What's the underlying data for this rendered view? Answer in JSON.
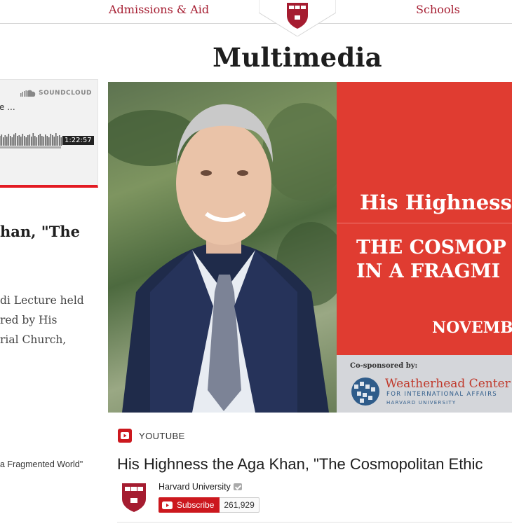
{
  "nav": {
    "admissions_label": "Admissions & Aid",
    "schools_label": "Schools",
    "logo": "harvard-shield-icon"
  },
  "page": {
    "title": "Multimedia"
  },
  "soundcloud": {
    "brand": "SOUNDCLOUD",
    "track_title_fragment": "e ...",
    "duration": "1:22:57",
    "accent_color": "#e31b23"
  },
  "left_article": {
    "heading_fragment": "han, \"The",
    "body_lines": [
      "di Lecture held",
      "red by His",
      "rial Church,"
    ],
    "caption_fragment": "a Fragmented World\""
  },
  "video": {
    "graphic": {
      "line1": "His Highness",
      "line2a": "THE COSMOP",
      "line2b": "IN A FRAGMI",
      "line3": "NOVEMB",
      "cosponsor_label": "Co-sponsored by:",
      "cosponsor_name": "Weatherhead Center",
      "cosponsor_sub1": "FOR INTERNATIONAL AFFAIRS",
      "cosponsor_sub2": "HARVARD UNIVERSITY"
    },
    "source_label": "YOUTUBE",
    "title": "His Highness the Aga Khan, \"The Cosmopolitan Ethic",
    "channel_name": "Harvard University",
    "subscribe_label": "Subscribe",
    "subscriber_count": "261,929"
  },
  "colors": {
    "harvard_crimson": "#a51c30",
    "youtube_red": "#cc181e",
    "graphic_red": "#e03c31"
  }
}
